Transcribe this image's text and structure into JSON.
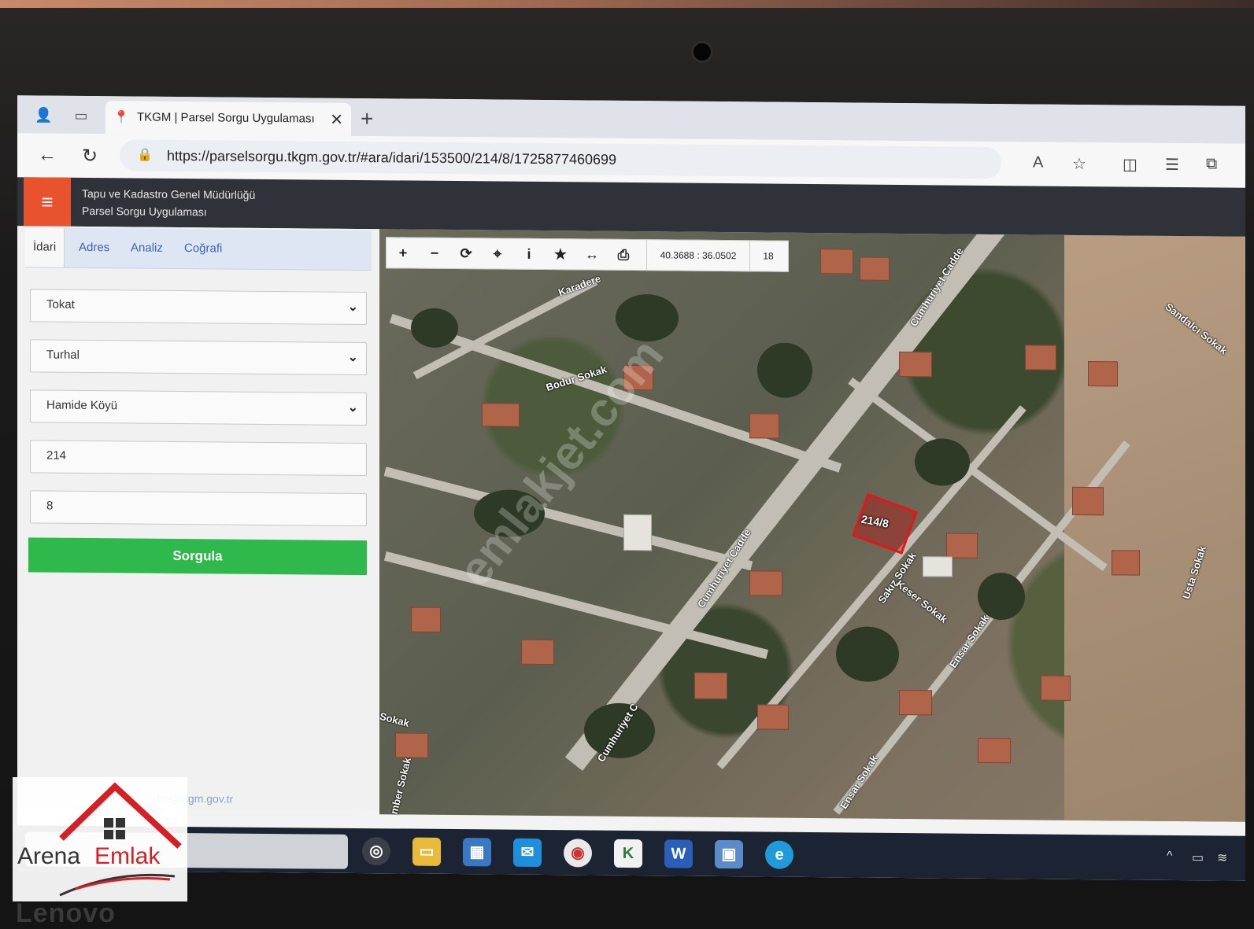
{
  "browser": {
    "tab_title": "TKGM | Parsel Sorgu Uygulaması",
    "url": "https://parselsorgu.tkgm.gov.tr/#ara/idari/153500/214/8/1725877460699"
  },
  "app": {
    "title_line1": "Tapu ve Kadastro Genel Müdürlüğü",
    "title_line2": "Parsel Sorgu Uygulaması"
  },
  "panel": {
    "tabs": [
      "İdari",
      "Adres",
      "Analiz",
      "Coğrafi"
    ],
    "active_tab": "İdari",
    "fields": {
      "il": "Tokat",
      "ilce": "Turhal",
      "mahalle": "Hamide Köyü",
      "ada": "214",
      "parsel": "8"
    },
    "submit_label": "Sorgula",
    "footer_email": "cbs@tkgm.gov.tr"
  },
  "map": {
    "coordinates": "40.3688 : 36.0502",
    "zoom": "18",
    "parcel_label": "214/8",
    "streets": [
      "Karadere",
      "Cumhuriyet Cadde",
      "Bodur Sokak",
      "Cumhuriyet Cadde",
      "Sakız Sokak",
      "Keser Sokak",
      "Ensar Sokak",
      "Sandalcı Sokak",
      "Usta Sokak",
      "Cumhuriyet C",
      "Ensar Sokak",
      "Sokak",
      "mber Sokak"
    ],
    "watermark": "emlakjet.com"
  },
  "logo": {
    "part1": "Arena",
    "part2": "Emlak"
  },
  "device_brand": "Lenovo"
}
